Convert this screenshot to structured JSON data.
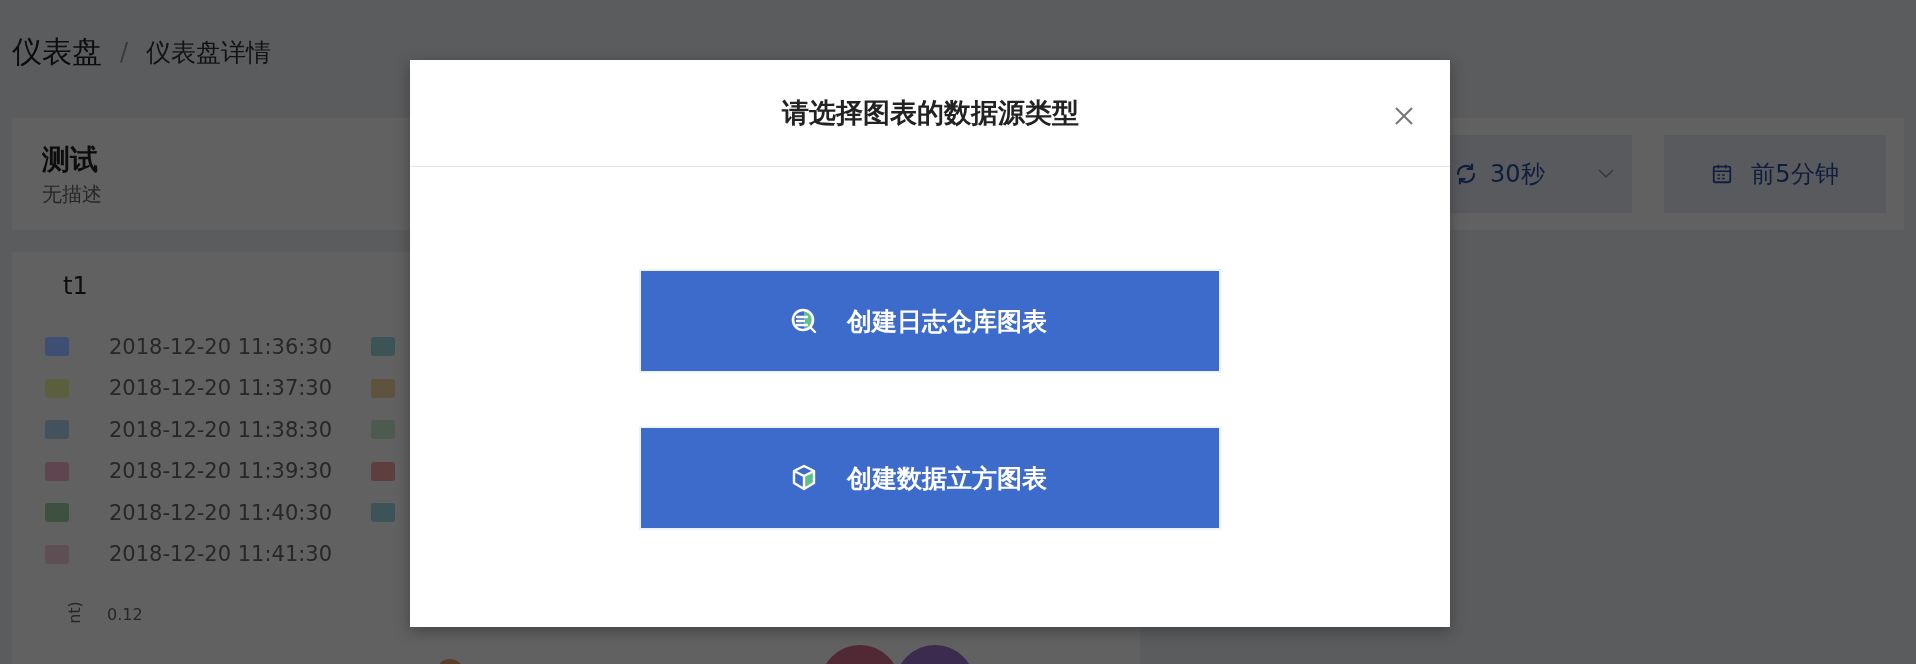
{
  "breadcrumb": [
    {
      "label": "仪表盘"
    },
    {
      "label": "仪表盘详情"
    }
  ],
  "breadcrumb_separator": "/",
  "dashboard": {
    "title": "测试",
    "description": "无描述",
    "refresh": {
      "value": "30秒"
    },
    "time_range": {
      "label": "前5分钟"
    }
  },
  "panel": {
    "title": "t1",
    "legend": [
      {
        "color": "#3f4f74",
        "label": "2018-12-20 11:36:30"
      },
      {
        "color": "#5c5f3e",
        "label": "2018-12-20 11:37:30"
      },
      {
        "color": "#44525e",
        "label": "2018-12-20 11:38:30"
      },
      {
        "color": "#5e4550",
        "label": "2018-12-20 11:39:30"
      },
      {
        "color": "#3e5040",
        "label": "2018-12-20 11:40:30"
      },
      {
        "color": "#5e4f55",
        "label": "2018-12-20 11:41:30"
      },
      {
        "color": "#3c5456"
      },
      {
        "color": "#5e533e"
      },
      {
        "color": "#4c5a4f"
      },
      {
        "color": "#5e3f3f"
      },
      {
        "color": "#3c5458"
      }
    ],
    "y_axis_label": "nt)",
    "y_tick": "0.12"
  },
  "modal": {
    "title": "请选择图表的数据源类型",
    "options": [
      {
        "kind": "log",
        "label": "创建日志仓库图表"
      },
      {
        "kind": "cube",
        "label": "创建数据立方图表"
      }
    ]
  }
}
